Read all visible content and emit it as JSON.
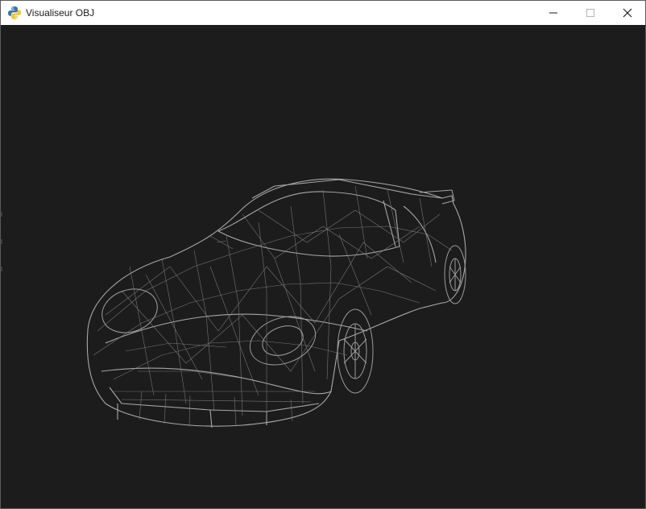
{
  "window": {
    "title": "Visualiseur OBJ",
    "app_icon": "python-logo-icon",
    "controls": [
      "minimize-icon",
      "maximize-icon",
      "close-icon"
    ]
  },
  "viewport": {
    "background_color": "#1c1c1c",
    "wire_color": "#9a9a9a",
    "model": "wireframe-sports-car"
  }
}
